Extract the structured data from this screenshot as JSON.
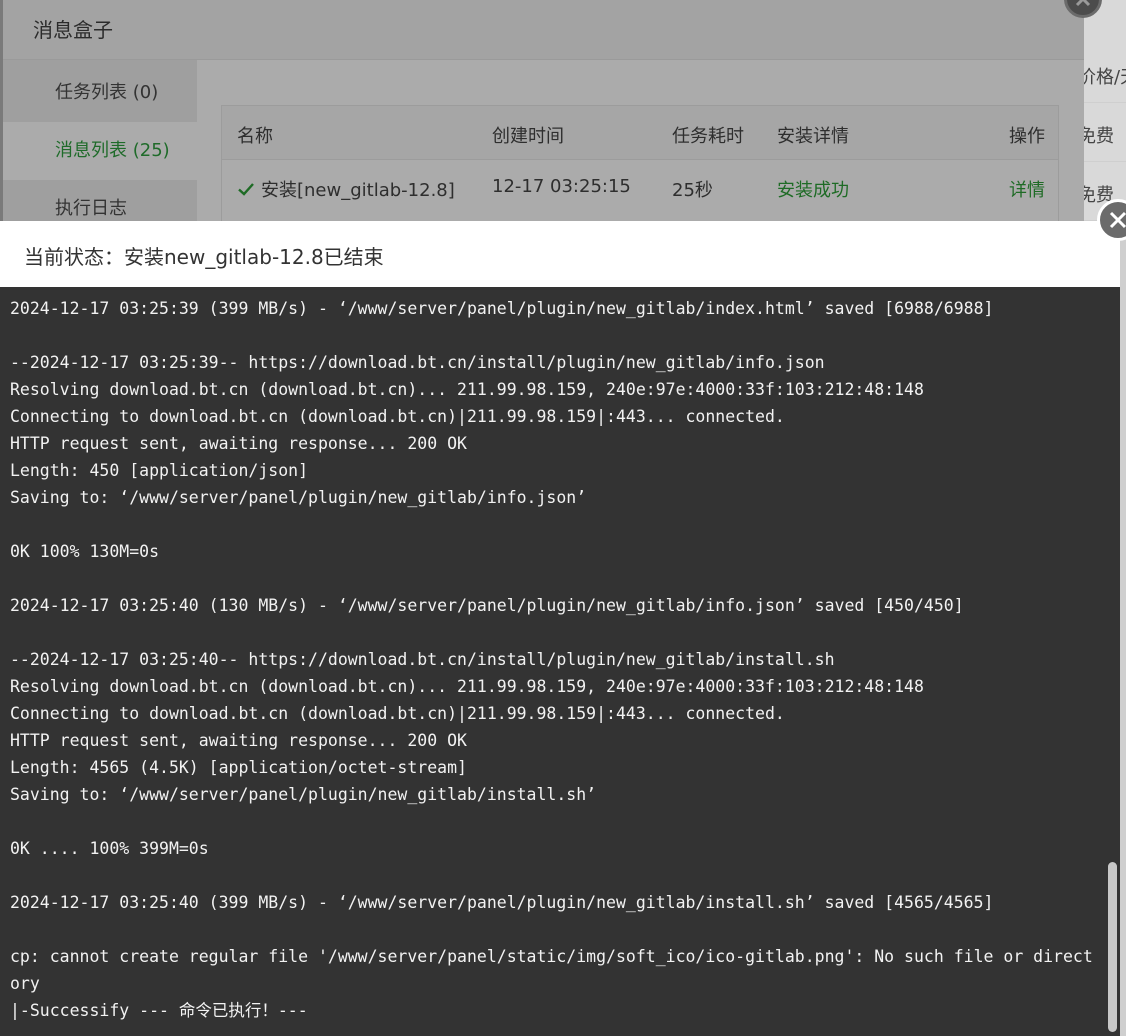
{
  "message_box": {
    "title": "消息盒子",
    "tabs": [
      {
        "label": "任务列表 (0)"
      },
      {
        "label": "消息列表 (25)"
      },
      {
        "label": "执行日志"
      }
    ],
    "table": {
      "headers": [
        "名称",
        "创建时间",
        "任务耗时",
        "安装详情",
        "操作"
      ],
      "rows": [
        {
          "name": "安装[new_gitlab-12.8]",
          "created": "12-17 03:25:15",
          "duration": "25秒",
          "detail": "安装成功",
          "action": "详情"
        }
      ]
    }
  },
  "background_page": {
    "rows": [
      "价格/天",
      "免费",
      "免费"
    ]
  },
  "status": {
    "text": "当前状态：安装new_gitlab-12.8已结束"
  },
  "terminal": {
    "lines": [
      "2024-12-17 03:25:39 (399 MB/s) - ‘/www/server/panel/plugin/new_gitlab/index.html’ saved [6988/6988]",
      "",
      "--2024-12-17 03:25:39-- https://download.bt.cn/install/plugin/new_gitlab/info.json",
      "Resolving download.bt.cn (download.bt.cn)... 211.99.98.159, 240e:97e:4000:33f:103:212:48:148",
      "Connecting to download.bt.cn (download.bt.cn)|211.99.98.159|:443... connected.",
      "HTTP request sent, awaiting response... 200 OK",
      "Length: 450 [application/json]",
      "Saving to: ‘/www/server/panel/plugin/new_gitlab/info.json’",
      "",
      "0K 100% 130M=0s",
      "",
      "2024-12-17 03:25:40 (130 MB/s) - ‘/www/server/panel/plugin/new_gitlab/info.json’ saved [450/450]",
      "",
      "--2024-12-17 03:25:40-- https://download.bt.cn/install/plugin/new_gitlab/install.sh",
      "Resolving download.bt.cn (download.bt.cn)... 211.99.98.159, 240e:97e:4000:33f:103:212:48:148",
      "Connecting to download.bt.cn (download.bt.cn)|211.99.98.159|:443... connected.",
      "HTTP request sent, awaiting response... 200 OK",
      "Length: 4565 (4.5K) [application/octet-stream]",
      "Saving to: ‘/www/server/panel/plugin/new_gitlab/install.sh’",
      "",
      "0K .... 100% 399M=0s",
      "",
      "2024-12-17 03:25:40 (399 MB/s) - ‘/www/server/panel/plugin/new_gitlab/install.sh’ saved [4565/4565]",
      "",
      "cp: cannot create regular file '/www/server/panel/static/img/soft_ico/ico-gitlab.png': No such file or direct",
      "ory",
      "|-Successify --- 命令已执行！---"
    ]
  },
  "colors": {
    "terminal_bg": "#333333",
    "terminal_text": "#f2f2f2",
    "success_green": "#1e6b25"
  }
}
